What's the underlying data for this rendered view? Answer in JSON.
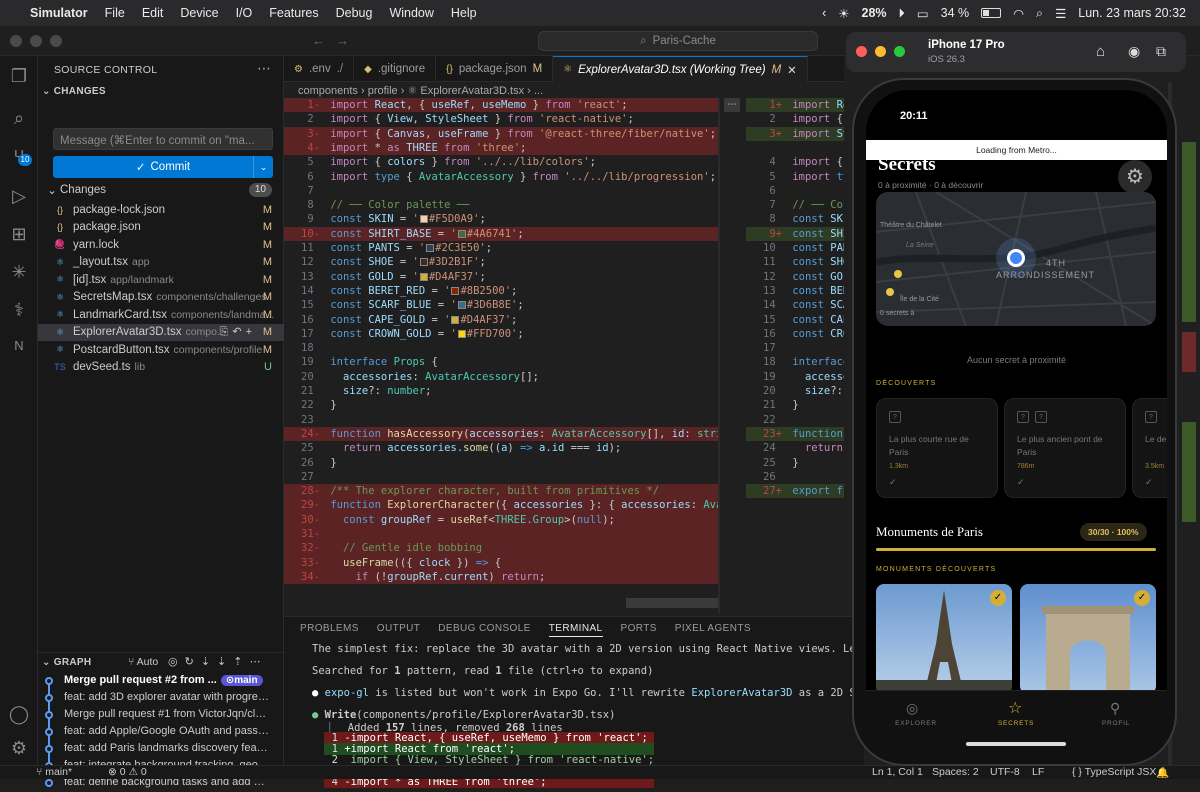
{
  "menubar": {
    "apple_icon": "apple-logo",
    "items": [
      "Simulator",
      "File",
      "Edit",
      "Device",
      "I/O",
      "Features",
      "Debug",
      "Window",
      "Help"
    ],
    "weather": "28%",
    "battery": "34 %",
    "datetime": "Lun. 23 mars  20:32"
  },
  "window": {
    "search": "Paris-Cache"
  },
  "activity": {
    "scm_badge": "10"
  },
  "sidebar": {
    "title": "SOURCE CONTROL",
    "changes_title": "CHANGES",
    "message_placeholder": "Message (⌘Enter to commit on \"ma...",
    "commit_label": "Commit",
    "changes_label": "Changes",
    "changes_count": "10",
    "files": [
      {
        "icon": "{}",
        "name": "package-lock.json",
        "path": "",
        "status": "M",
        "color": "#e2c08d"
      },
      {
        "icon": "{}",
        "name": "package.json",
        "path": "",
        "status": "M",
        "color": "#e2c08d"
      },
      {
        "icon": "🧶",
        "name": "yarn.lock",
        "path": "",
        "status": "M",
        "color": "#4aa8d8"
      },
      {
        "icon": "⚛",
        "name": "_layout.tsx",
        "path": "app",
        "status": "M",
        "color": "#4fc1e9"
      },
      {
        "icon": "⚛",
        "name": "[id].tsx",
        "path": "app/landmark",
        "status": "M",
        "color": "#4fc1e9"
      },
      {
        "icon": "⚛",
        "name": "SecretsMap.tsx",
        "path": "components/challenges",
        "status": "M",
        "color": "#4fc1e9"
      },
      {
        "icon": "⚛",
        "name": "LandmarkCard.tsx",
        "path": "components/landma...",
        "status": "M",
        "color": "#4fc1e9"
      },
      {
        "icon": "⚛",
        "name": "ExplorerAvatar3D.tsx",
        "path": "compo...",
        "status": "M",
        "color": "#4fc1e9"
      },
      {
        "icon": "⚛",
        "name": "PostcardButton.tsx",
        "path": "components/profile",
        "status": "M",
        "color": "#4fc1e9"
      },
      {
        "icon": "TS",
        "name": "devSeed.ts",
        "path": "lib",
        "status": "U",
        "color": "#3178c6"
      }
    ],
    "graph_title": "GRAPH",
    "graph_auto": "Auto",
    "graph": [
      {
        "text": "Merge pull request #2 from ...",
        "branch": "main",
        "bold": true
      },
      {
        "text": "feat: add 3D explorer avatar with progres...",
        "branch": "",
        "bold": false
      },
      {
        "text": "Merge pull request #1 from VictorJqn/cla...",
        "branch": "",
        "bold": false
      },
      {
        "text": "feat: add Apple/Google OAuth and passw...",
        "branch": "",
        "bold": false
      },
      {
        "text": "feat: add Paris landmarks discovery featu...",
        "branch": "",
        "bold": false
      },
      {
        "text": "feat: integrate background tracking, geof...",
        "branch": "",
        "bold": false
      },
      {
        "text": "feat: define background tasks and add bac...",
        "branch": "",
        "bold": false
      }
    ]
  },
  "tabs": [
    {
      "label": ".env",
      "sub": "./",
      "icon": "⚙",
      "status": "",
      "active": false
    },
    {
      "label": ".gitignore",
      "sub": "",
      "icon": "◆",
      "status": "",
      "active": false
    },
    {
      "label": "package.json",
      "sub": "",
      "icon": "{}",
      "status": "M",
      "active": false
    },
    {
      "label": "ExplorerAvatar3D.tsx (Working Tree)",
      "sub": "",
      "icon": "⚛",
      "status": "M",
      "active": true
    }
  ],
  "breadcrumb": "components  ›  profile  ›  ⚛ ExplorerAvatar3D.tsx  ›  ...",
  "code_left": [
    {
      "n": "1",
      "m": "-",
      "t": "del",
      "html": "<span class='kw2'>import</span> <span class='var'>React</span>, { <span class='var'>useRef</span>, <span class='var'>useMemo</span> } <span class='kw2'>from</span> <span class='str'>'react'</span>;"
    },
    {
      "n": "2",
      "m": "",
      "t": "",
      "html": "<span class='kw2'>import</span> { <span class='var'>View</span>, <span class='var'>StyleSheet</span> } <span class='kw2'>from</span> <span class='str'>'react-native'</span>;"
    },
    {
      "n": "3",
      "m": "-",
      "t": "del",
      "html": "<span class='kw2'>import</span> { <span class='var'>Canvas</span>, <span class='var'>useFrame</span> } <span class='kw2'>from</span> <span class='str'>'@react-three/fiber/native'</span>;"
    },
    {
      "n": "4",
      "m": "-",
      "t": "del",
      "html": "<span class='kw2'>import</span> * <span class='kw2'>as</span> <span class='var'>THREE</span> <span class='kw2'>from</span> <span class='str'>'three'</span>;"
    },
    {
      "n": "5",
      "m": "",
      "t": "",
      "html": "<span class='kw2'>import</span> { <span class='var'>colors</span> } <span class='kw2'>from</span> <span class='str'>'../../lib/colors'</span>;"
    },
    {
      "n": "6",
      "m": "",
      "t": "",
      "html": "<span class='kw2'>import</span> <span class='kw'>type</span> { <span class='ty'>AvatarAccessory</span> } <span class='kw2'>from</span> <span class='str'>'../../lib/progression'</span>;"
    },
    {
      "n": "7",
      "m": "",
      "t": "",
      "html": ""
    },
    {
      "n": "8",
      "m": "",
      "t": "",
      "html": "<span class='cm'>// ── Color palette ──</span>"
    },
    {
      "n": "9",
      "m": "",
      "t": "",
      "html": "<span class='kw'>const</span> <span class='var'>SKIN</span> = <span class='str'>'<span class=\"swatch\" style=\"background:#F5D0A9\"></span>#F5D0A9'</span>;"
    },
    {
      "n": "10",
      "m": "-",
      "t": "del",
      "html": "<span class='kw'>const</span> <span class='var'>SHIRT_BASE</span> = <span class='str'>'<span class=\"swatch\" style=\"background:#4A6741\"></span>#4A6741'</span>;"
    },
    {
      "n": "11",
      "m": "",
      "t": "",
      "html": "<span class='kw'>const</span> <span class='var'>PANTS</span> = <span class='str'>'<span class=\"swatch\" style=\"background:#2C3E50\"></span>#2C3E50'</span>;"
    },
    {
      "n": "12",
      "m": "",
      "t": "",
      "html": "<span class='kw'>const</span> <span class='var'>SHOE</span> = <span class='str'>'<span class=\"swatch\" style=\"background:#3D2B1F\"></span>#3D2B1F'</span>;"
    },
    {
      "n": "13",
      "m": "",
      "t": "",
      "html": "<span class='kw'>const</span> <span class='var'>GOLD</span> = <span class='str'>'<span class=\"swatch\" style=\"background:#D4AF37\"></span>#D4AF37'</span>;"
    },
    {
      "n": "14",
      "m": "",
      "t": "",
      "html": "<span class='kw'>const</span> <span class='var'>BERET_RED</span> = <span class='str'>'<span class=\"swatch\" style=\"background:#8B2500\"></span>#8B2500'</span>;"
    },
    {
      "n": "15",
      "m": "",
      "t": "",
      "html": "<span class='kw'>const</span> <span class='var'>SCARF_BLUE</span> = <span class='str'>'<span class=\"swatch\" style=\"background:#3D6B8E\"></span>#3D6B8E'</span>;"
    },
    {
      "n": "16",
      "m": "",
      "t": "",
      "html": "<span class='kw'>const</span> <span class='var'>CAPE_GOLD</span> = <span class='str'>'<span class=\"swatch\" style=\"background:#D4AF37\"></span>#D4AF37'</span>;"
    },
    {
      "n": "17",
      "m": "",
      "t": "",
      "html": "<span class='kw'>const</span> <span class='var'>CROWN_GOLD</span> = <span class='str'>'<span class=\"swatch\" style=\"background:#FFD700\"></span>#FFD700'</span>;"
    },
    {
      "n": "18",
      "m": "",
      "t": "",
      "html": ""
    },
    {
      "n": "19",
      "m": "",
      "t": "",
      "html": "<span class='kw'>interface</span> <span class='ty'>Props</span> {"
    },
    {
      "n": "20",
      "m": "",
      "t": "",
      "html": "  <span class='var'>accessories</span>: <span class='ty'>AvatarAccessory</span>[];"
    },
    {
      "n": "21",
      "m": "",
      "t": "",
      "html": "  <span class='var'>size</span>?: <span class='ty'>number</span>;"
    },
    {
      "n": "22",
      "m": "",
      "t": "",
      "html": "}"
    },
    {
      "n": "23",
      "m": "",
      "t": "",
      "html": ""
    },
    {
      "n": "24",
      "m": "-",
      "t": "del",
      "html": "<span class='kw'>function</span> <span class='fn'>hasAccessory</span>(<span class='var'>accessories</span>: <span class='ty'>AvatarAccessory</span>[], <span class='var'>id</span>: <span class='ty'>string</span>) {"
    },
    {
      "n": "25",
      "m": "",
      "t": "",
      "html": "  <span class='kw2'>return</span> <span class='var'>accessories</span>.<span class='fn'>some</span>((<span class='var'>a</span>) <span class='kw'>=></span> <span class='var'>a</span>.<span class='var'>id</span> === <span class='var'>id</span>);"
    },
    {
      "n": "26",
      "m": "",
      "t": "",
      "html": "}"
    },
    {
      "n": "27",
      "m": "",
      "t": "",
      "html": ""
    },
    {
      "n": "28",
      "m": "-",
      "t": "del",
      "html": "<span class='cm'>/** The explorer character, built from primitives */</span>"
    },
    {
      "n": "29",
      "m": "-",
      "t": "del",
      "html": "<span class='kw'>function</span> <span class='fn'>ExplorerCharacter</span>({ <span class='var'>accessories</span> }: { <span class='var'>accessories</span>: <span class='ty'>AvatarAcc</span>"
    },
    {
      "n": "30",
      "m": "-",
      "t": "del",
      "html": "  <span class='kw'>const</span> <span class='var'>groupRef</span> = <span class='fn'>useRef</span>&lt;<span class='ty'>THREE.Group</span>&gt;(<span class='kw'>null</span>);"
    },
    {
      "n": "31",
      "m": "-",
      "t": "del",
      "html": ""
    },
    {
      "n": "32",
      "m": "-",
      "t": "del",
      "html": "  <span class='cm'>// Gentle idle bobbing</span>"
    },
    {
      "n": "33",
      "m": "-",
      "t": "del",
      "html": "  <span class='fn'>useFrame</span>(({ <span class='var'>clock</span> }) <span class='kw'>=></span> {"
    },
    {
      "n": "34",
      "m": "-",
      "t": "del",
      "html": "    <span class='kw2'>if</span> (!<span class='var'>groupRef</span>.<span class='var'>current</span>) <span class='kw2'>return</span>;"
    }
  ],
  "code_right": [
    {
      "n": "1",
      "m": "+",
      "t": "add",
      "html": "<span class='kw2'>import</span> <span class='var'>React</span>"
    },
    {
      "n": "2",
      "m": "",
      "t": "",
      "html": "<span class='kw2'>import</span> { <span class='var'>Vie</span>"
    },
    {
      "n": "3",
      "m": "+",
      "t": "add",
      "html": "<span class='kw2'>import</span> <span class='var'>Svg</span>,"
    },
    {
      "n": "",
      "m": "",
      "t": "",
      "html": ""
    },
    {
      "n": "4",
      "m": "",
      "t": "",
      "html": "<span class='kw2'>import</span> { <span class='var'>co</span>"
    },
    {
      "n": "5",
      "m": "",
      "t": "",
      "html": "<span class='kw2'>import</span> <span class='kw'>type</span>"
    },
    {
      "n": "6",
      "m": "",
      "t": "",
      "html": ""
    },
    {
      "n": "7",
      "m": "",
      "t": "",
      "html": "<span class='cm'>// ── Colo</span>"
    },
    {
      "n": "8",
      "m": "",
      "t": "",
      "html": "<span class='kw'>const</span> <span class='var'>SKIN</span>"
    },
    {
      "n": "9",
      "m": "+",
      "t": "add",
      "html": "<span class='kw'>const</span> <span class='var'>SHIRT</span>"
    },
    {
      "n": "10",
      "m": "",
      "t": "",
      "html": "<span class='kw'>const</span> <span class='var'>PANTS</span>"
    },
    {
      "n": "11",
      "m": "",
      "t": "",
      "html": "<span class='kw'>const</span> <span class='var'>SHOE</span>"
    },
    {
      "n": "12",
      "m": "",
      "t": "",
      "html": "<span class='kw'>const</span> <span class='var'>GOLD</span>"
    },
    {
      "n": "13",
      "m": "",
      "t": "",
      "html": "<span class='kw'>const</span> <span class='var'>BERET</span>"
    },
    {
      "n": "14",
      "m": "",
      "t": "",
      "html": "<span class='kw'>const</span> <span class='var'>SCARF</span>"
    },
    {
      "n": "15",
      "m": "",
      "t": "",
      "html": "<span class='kw'>const</span> <span class='var'>CAPE</span>"
    },
    {
      "n": "16",
      "m": "",
      "t": "",
      "html": "<span class='kw'>const</span> <span class='var'>CROWN</span>"
    },
    {
      "n": "17",
      "m": "",
      "t": "",
      "html": ""
    },
    {
      "n": "18",
      "m": "",
      "t": "",
      "html": "<span class='kw'>interface</span> <span class='ty'>F</span>"
    },
    {
      "n": "19",
      "m": "",
      "t": "",
      "html": "  <span class='var'>accessori</span>"
    },
    {
      "n": "20",
      "m": "",
      "t": "",
      "html": "  <span class='var'>size</span>?: <span class='ty'>nu</span>"
    },
    {
      "n": "21",
      "m": "",
      "t": "",
      "html": "}"
    },
    {
      "n": "22",
      "m": "",
      "t": "",
      "html": ""
    },
    {
      "n": "23",
      "m": "+",
      "t": "add",
      "html": "<span class='kw'>function</span> <span class='fn'>ha</span>"
    },
    {
      "n": "24",
      "m": "",
      "t": "",
      "html": "  <span class='kw2'>return</span> <span class='var'>ac</span>"
    },
    {
      "n": "25",
      "m": "",
      "t": "",
      "html": "}"
    },
    {
      "n": "26",
      "m": "",
      "t": "",
      "html": ""
    },
    {
      "n": "27",
      "m": "+",
      "t": "add",
      "html": "<span class='kw'>export</span> <span class='kw'>func</span>"
    }
  ],
  "panel": {
    "tabs": [
      "PROBLEMS",
      "OUTPUT",
      "DEBUG CONSOLE",
      "TERMINAL",
      "PORTS",
      "PIXEL AGENTS"
    ],
    "active_tab": "TERMINAL",
    "lines": [
      {
        "html": "The simplest fix: replace the 3D avatar with a 2D version using React Native views. Let me check"
      },
      {
        "html": ""
      },
      {
        "html": "Searched for <b>1</b> pattern, read <b>1</b> file (ctrl+o to expand)"
      },
      {
        "html": ""
      },
      {
        "html": "<span style='color:#ffffff'>●</span> <span style='color:#9cdcfe'>expo-gl</span> is listed but won't work in Expo Go. I'll rewrite <span style='color:#9cdcfe'>ExplorerAvatar3D</span> as a 2D SVG avatar usi"
      },
      {
        "html": ""
      },
      {
        "html": "<span style='color:#73c991'>●</span> <b>Write</b>(components/profile/ExplorerAvatar3D.tsx)"
      },
      {
        "html": "  ⎿  Added <b>157</b> lines, removed <b>268</b> lines"
      }
    ],
    "diff": [
      {
        "n": "1",
        "m": "-",
        "text": "import React, { useRef, useMemo } from 'react';",
        "type": "del"
      },
      {
        "n": "1",
        "m": "+",
        "text": "import React from 'react';",
        "type": "add"
      },
      {
        "n": "2",
        "m": " ",
        "text": "import { View, StyleSheet } from 'react-native';",
        "type": "ctx"
      },
      {
        "n": "3",
        "m": "-",
        "text": "import { Canvas, useFrame } from '@react-three/fiber/native';",
        "type": "del"
      },
      {
        "n": "4",
        "m": "-",
        "text": "import * as THREE from 'three';",
        "type": "del"
      }
    ]
  },
  "statusbar": {
    "branch": "main*",
    "errors": "0",
    "warnings": "0",
    "position": "Ln 1, Col 1",
    "spaces": "Spaces: 2",
    "encoding": "UTF-8",
    "eol": "LF",
    "language": "{ } TypeScript JSX"
  },
  "simulator": {
    "device": "iPhone 17 Pro",
    "os": "iOS 26.3",
    "screen": {
      "time": "20:11",
      "metro": "Loading from Metro...",
      "title": "Secrets",
      "subtitle": "0 à proximité · 0 à découvrir",
      "map_labels": [
        "Théâtre du Châtelet",
        "La Seine",
        "4TH",
        "ARRONDISSEMENT",
        "Île de la Cité",
        "0 secrets à"
      ],
      "empty": "Aucun secret à proximité",
      "discovered_title": "DÉCOUVERTS",
      "cards": [
        {
          "title": "La plus courte rue de Paris",
          "dist": "1.3km"
        },
        {
          "title": "Le plus ancien pont de Paris",
          "dist": "786m"
        },
        {
          "title": "Le de",
          "dist": "3.5km"
        }
      ],
      "monuments_title": "Monuments de Paris",
      "monuments_badge": "30/30 · 100%",
      "monuments_progress": 1.0,
      "monuments_discovered": "MONUMENTS DÉCOUVERTS",
      "nav": [
        {
          "label": "EXPLORER",
          "active": false
        },
        {
          "label": "SECRETS",
          "active": true
        },
        {
          "label": "PROFIL",
          "active": false
        }
      ]
    }
  },
  "colors": {
    "accent": "#0078d4",
    "gold": "#d4af37",
    "deleted": "#8c2626",
    "added": "#3c5a28"
  }
}
